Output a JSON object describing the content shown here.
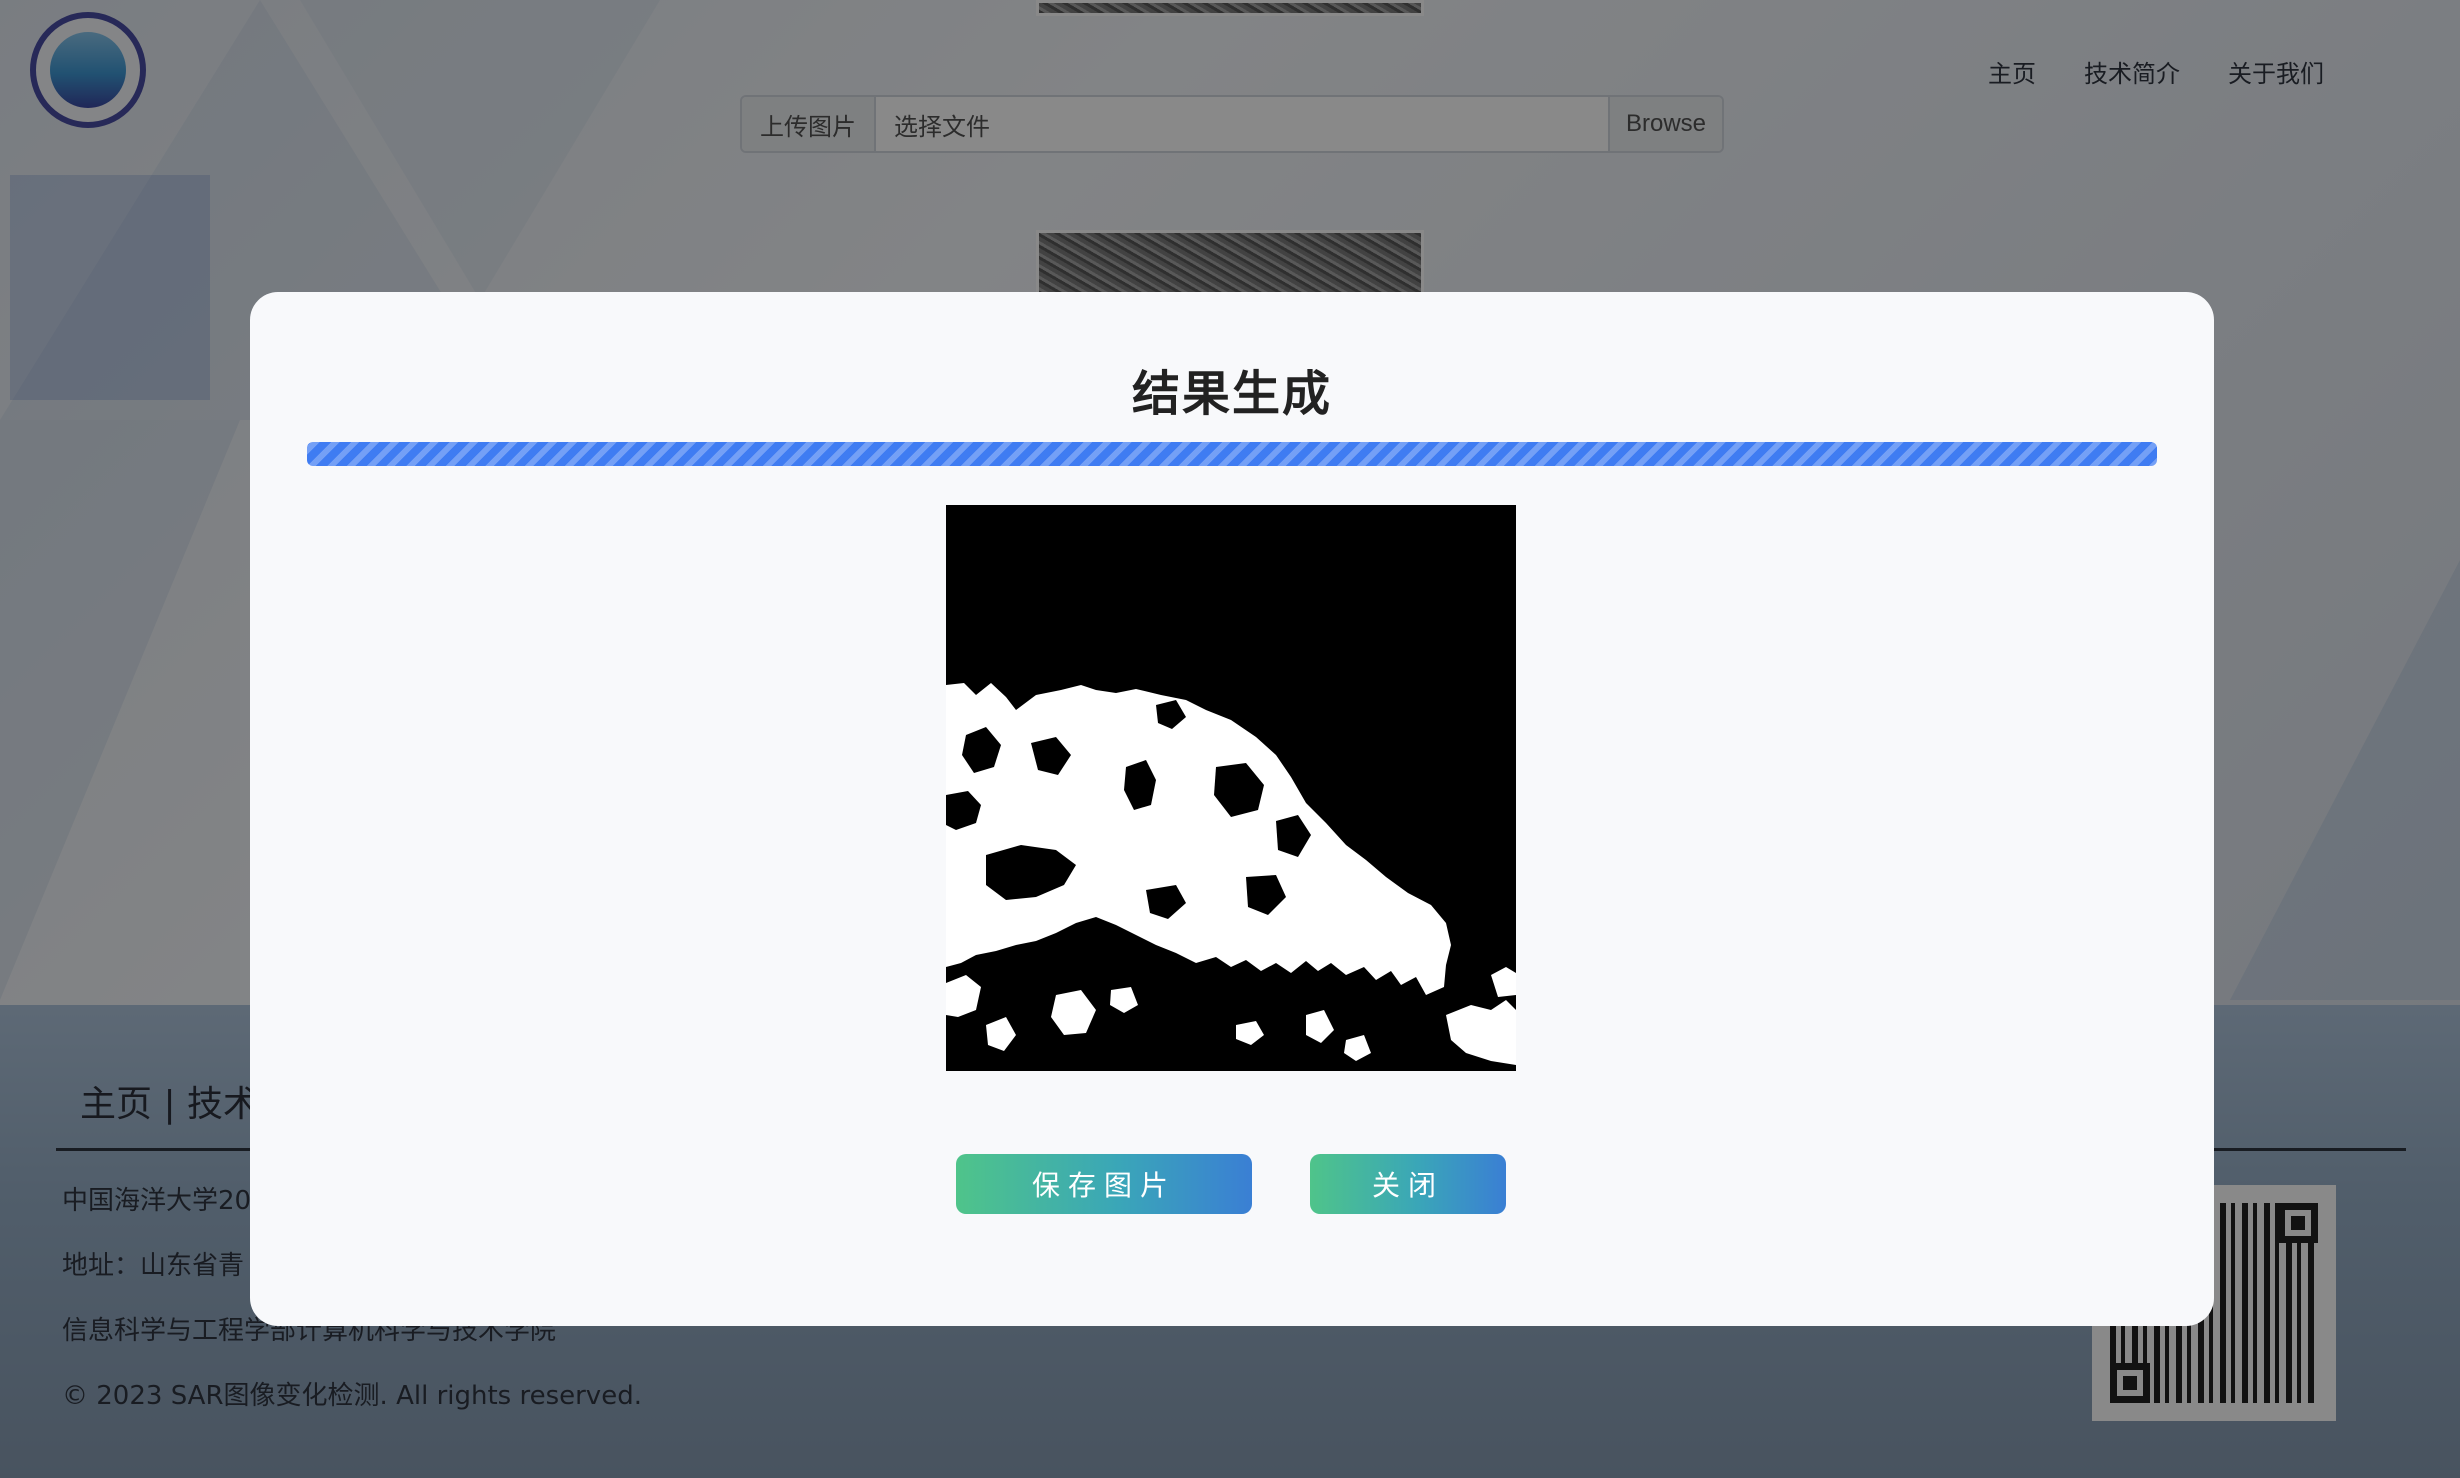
{
  "nav": {
    "items": [
      "主页",
      "技术简介",
      "关于我们"
    ]
  },
  "upload": {
    "label": "上传图片",
    "placeholder": "选择文件",
    "browse": "Browse"
  },
  "footer": {
    "links": "主页 | 技术",
    "line1": "中国海洋大学20",
    "line2": "地址：山东省青",
    "line3": "信息科学与工程学部计算机科学与技术学院",
    "copyright": "© 2023 SAR图像变化检测. All rights reserved."
  },
  "modal": {
    "title": "结果生成",
    "progress_fraction": 1.0,
    "save_label": "保存图片",
    "close_label": "关闭"
  },
  "colors": {
    "progress": "#3f7cf2",
    "button_gradient_start": "#4fc48a",
    "button_gradient_end": "#3a7fd4",
    "logo_ring": "#3b3f9c"
  },
  "icons": {
    "logo": "ocean-university-of-china-emblem",
    "qr": "qr-code"
  }
}
